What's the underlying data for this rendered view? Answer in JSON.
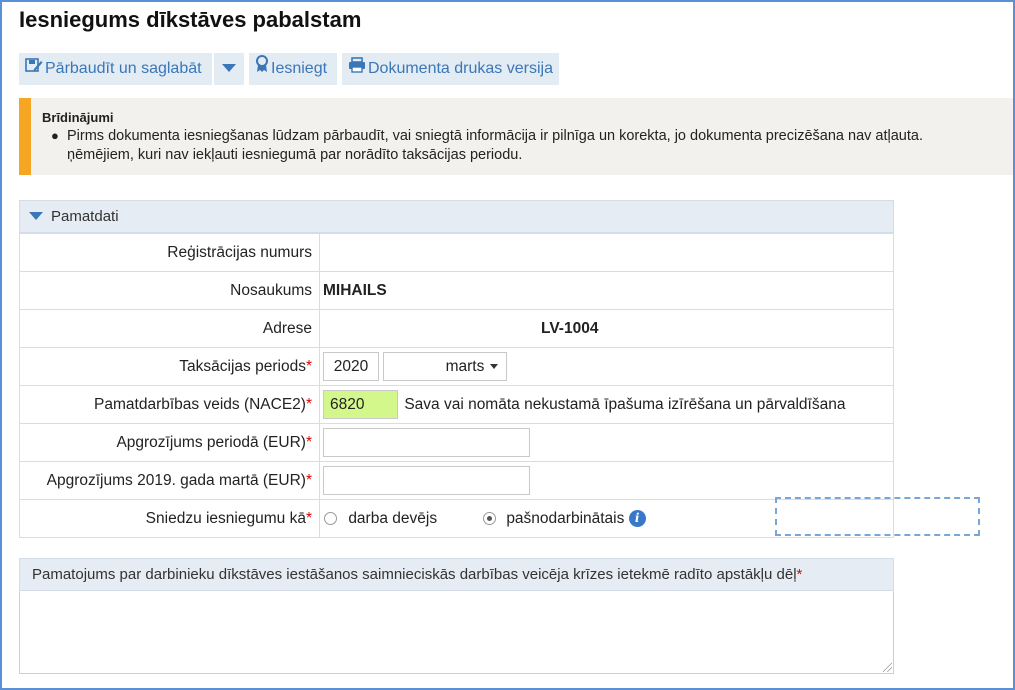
{
  "page": {
    "title": "Iesniegums dīkstāves pabalstam"
  },
  "toolbar": {
    "save_label": "Pārbaudīt un saglabāt",
    "submit_label": "Iesniegt",
    "print_label": "Dokumenta drukas versija"
  },
  "warning": {
    "title": "Brīdinājumi",
    "line1": "Pirms dokumenta iesniegšanas lūdzam pārbaudīt, vai sniegtā informācija ir pilnīga un korekta, jo dokumenta precizēšana nav atļauta.",
    "line2": "ņēmējiem, kuri nav iekļauti iesniegumā par norādīto taksācijas periodu."
  },
  "section": {
    "title": "Pamatdati",
    "reg_label": "Reģistrācijas numurs",
    "reg_value": "",
    "name_label": "Nosaukums",
    "name_value": "MIHAILS",
    "address_label": "Adrese",
    "address_value": "LV-1004",
    "period_label": "Taksācijas periods",
    "period_year": "2020",
    "period_month": "marts",
    "nace_label": "Pamatdarbības veids (NACE2)",
    "nace_code": "6820",
    "nace_desc": "Sava vai nomāta nekustamā īpašuma izīrēšana un pārvaldīšana",
    "turnover_label": "Apgrozījums periodā (EUR)",
    "turnover_value": "",
    "turnover2019_label": "Apgrozījums 2019. gada martā (EUR)",
    "turnover2019_value": "",
    "submitter_label": "Sniedzu iesniegumu kā",
    "option_employer": "darba devējs",
    "option_selfemployed": "pašnodarbinātais",
    "selected_option": "pašnodarbinātais"
  },
  "justification": {
    "label": "Pamatojums par darbinieku dīkstāves iestāšanos saimnieciskās darbības veicēja krīzes ietekmē radīto apstākļu dēļ",
    "value": ""
  },
  "colors": {
    "accent": "#3a77b8",
    "warning": "#f5a623",
    "highlight": "#d4f78b"
  }
}
